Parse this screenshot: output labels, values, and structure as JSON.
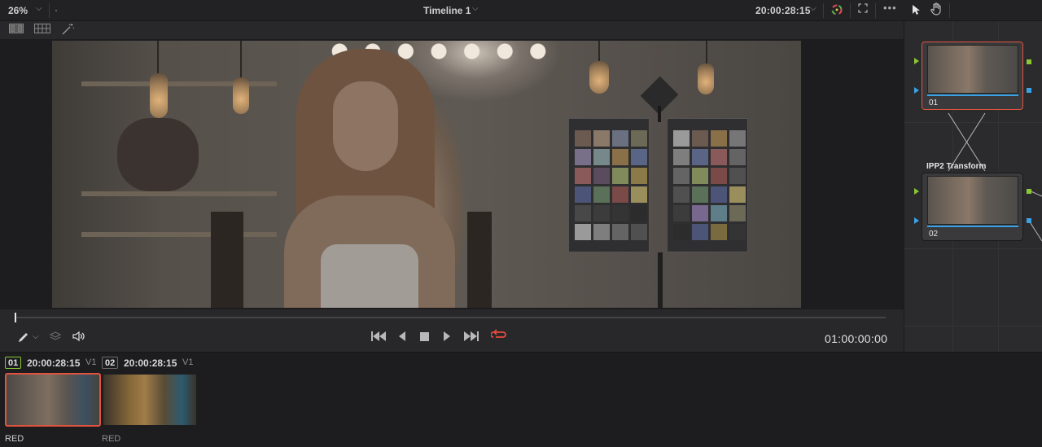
{
  "topbar": {
    "zoom": "26%",
    "timeline_title": "Timeline 1",
    "timecode": "20:00:28:15"
  },
  "viewer": {
    "timecode": "01:00:00:00",
    "playback_progress": 0
  },
  "node_editor": {
    "nodes": [
      {
        "number": "01",
        "title": "",
        "selected": true
      },
      {
        "number": "02",
        "title": "IPP2 Transform",
        "selected": false
      }
    ]
  },
  "clips": [
    {
      "number": "01",
      "timecode": "20:00:28:15",
      "track": "V1",
      "codec": "RED",
      "active": true
    },
    {
      "number": "02",
      "timecode": "20:00:28:15",
      "track": "V1",
      "codec": "RED",
      "active": false
    }
  ],
  "icons": {
    "zoom_dropdown": "chevron-down-icon",
    "timeline_dropdown": "chevron-down-icon",
    "timecode_dropdown": "chevron-down-icon",
    "color_picker": "color-wheel-icon",
    "fullscreen": "expand-icon",
    "more": "more-options-icon",
    "pointer": "pointer-icon",
    "hand": "hand-icon",
    "transport": [
      "skip-to-start-icon",
      "step-back-icon",
      "stop-icon",
      "play-icon",
      "skip-to-end-icon",
      "loop-icon"
    ]
  },
  "colors": {
    "accent_red": "#e0543f",
    "loop_red": "#e64b3c",
    "node_green": "#8ac834",
    "node_blue": "#3aa2e6"
  }
}
